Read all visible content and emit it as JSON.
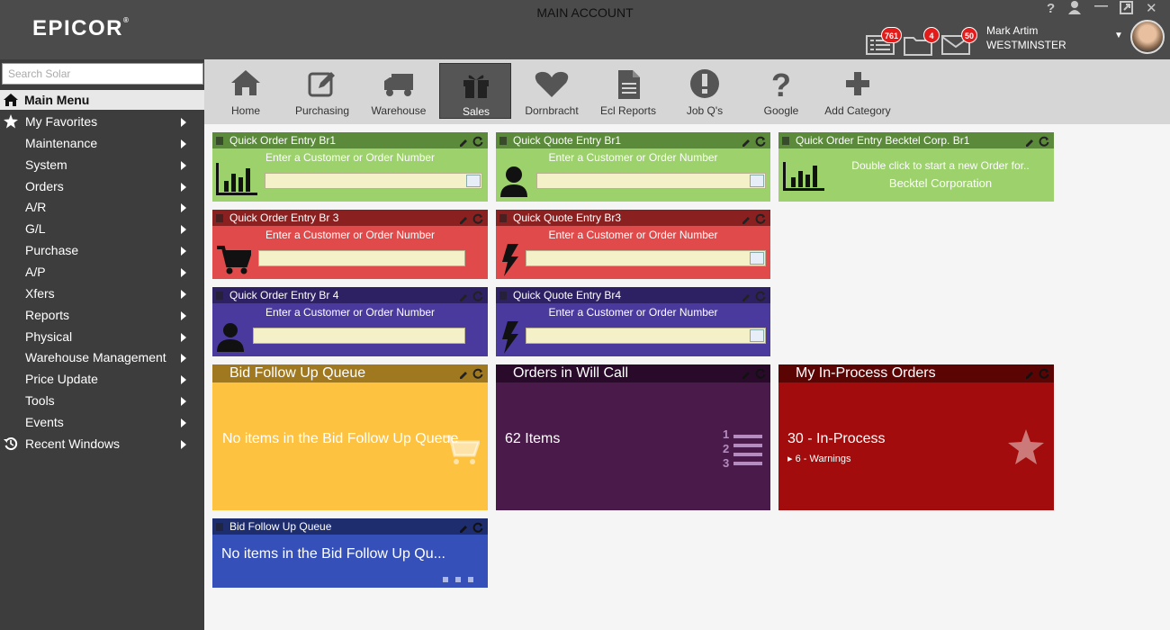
{
  "app": {
    "logo": "EPICOR",
    "logo_mark": "®",
    "window_title": "MAIN ACCOUNT"
  },
  "header": {
    "notifications": [
      {
        "icon": "list-icon",
        "count": "761"
      },
      {
        "icon": "folder-icon",
        "count": "4"
      },
      {
        "icon": "mail-icon",
        "count": "50"
      }
    ],
    "user_name": "Mark Artim",
    "user_location": "WESTMINSTER",
    "window_controls": {
      "help": "?",
      "minimize": "—",
      "maximize": "⤢",
      "close": "✕"
    }
  },
  "sidebar": {
    "search_placeholder": "Search Solar",
    "main_menu_label": "Main Menu",
    "items": [
      {
        "label": "My Favorites",
        "icon": "star-icon"
      },
      {
        "label": "Maintenance"
      },
      {
        "label": "System"
      },
      {
        "label": "Orders"
      },
      {
        "label": "A/R"
      },
      {
        "label": "G/L"
      },
      {
        "label": "Purchase"
      },
      {
        "label": "A/P"
      },
      {
        "label": "Xfers"
      },
      {
        "label": "Reports"
      },
      {
        "label": "Physical"
      },
      {
        "label": "Warehouse Management"
      },
      {
        "label": "Price Update"
      },
      {
        "label": "Tools"
      },
      {
        "label": "Events"
      },
      {
        "label": "Recent Windows",
        "icon": "history-icon"
      }
    ]
  },
  "toolbar": {
    "buttons": [
      {
        "label": "Home",
        "icon": "home-icon"
      },
      {
        "label": "Purchasing",
        "icon": "edit-icon"
      },
      {
        "label": "Warehouse",
        "icon": "truck-icon"
      },
      {
        "label": "Sales",
        "icon": "gift-icon",
        "active": true
      },
      {
        "label": "Dornbracht",
        "icon": "heart-icon"
      },
      {
        "label": "Ecl Reports",
        "icon": "document-icon"
      },
      {
        "label": "Job Q's",
        "icon": "exclamation-icon"
      },
      {
        "label": "Google",
        "icon": "question-icon"
      },
      {
        "label": "Add Category",
        "icon": "plus-icon"
      }
    ]
  },
  "widgets": {
    "qoe_br1": {
      "title": "Quick Order Entry Br1",
      "hint": "Enter a Customer or Order Number",
      "color": "#9cd16c",
      "header_color": "#5a8a3a"
    },
    "qqe_br1": {
      "title": "Quick Quote Entry Br1",
      "hint": "Enter a Customer or Order Number",
      "color": "#9cd16c",
      "header_color": "#5a8a3a"
    },
    "qoe_becktel": {
      "title": "Quick Order Entry Becktel Corp. Br1",
      "hint": "Double click to start a new Order for..",
      "customer": "Becktel Corporation",
      "color": "#9cd16c",
      "header_color": "#5a8a3a"
    },
    "qoe_br3": {
      "title": "Quick Order Entry Br 3",
      "hint": "Enter a Customer or Order Number",
      "color": "#e04a4a",
      "header_color": "#8b2020"
    },
    "qqe_br3": {
      "title": "Quick Quote Entry Br3",
      "hint": "Enter a Customer or Order Number",
      "color": "#e04a4a",
      "header_color": "#8b2020"
    },
    "qoe_br4": {
      "title": "Quick Order Entry Br 4",
      "hint": "Enter a Customer or Order Number",
      "color": "#4b3a9e",
      "header_color": "#2d2063"
    },
    "qqe_br4": {
      "title": "Quick Quote Entry Br4",
      "hint": "Enter a Customer or Order Number",
      "color": "#4b3a9e",
      "header_color": "#2d2063"
    },
    "bid_queue": {
      "title": "Bid Follow Up Queue",
      "text": "No items in the Bid Follow Up Queue",
      "color": "#fdc240",
      "header_color": "#a07820"
    },
    "will_call": {
      "title": "Orders in Will Call",
      "text": "62 Items",
      "color": "#4a1a4a",
      "header_color": "#2a0a2a"
    },
    "in_process": {
      "title": "My In-Process Orders",
      "text": "30 - In-Process",
      "subtext": "6 - Warnings",
      "color": "#a30c0c",
      "header_color": "#5a0404"
    },
    "bid_queue_2": {
      "title": "Bid Follow Up Queue",
      "text": "No items in the Bid Follow Up Qu...",
      "color": "#3550b8",
      "header_color": "#1e2d6e"
    }
  }
}
